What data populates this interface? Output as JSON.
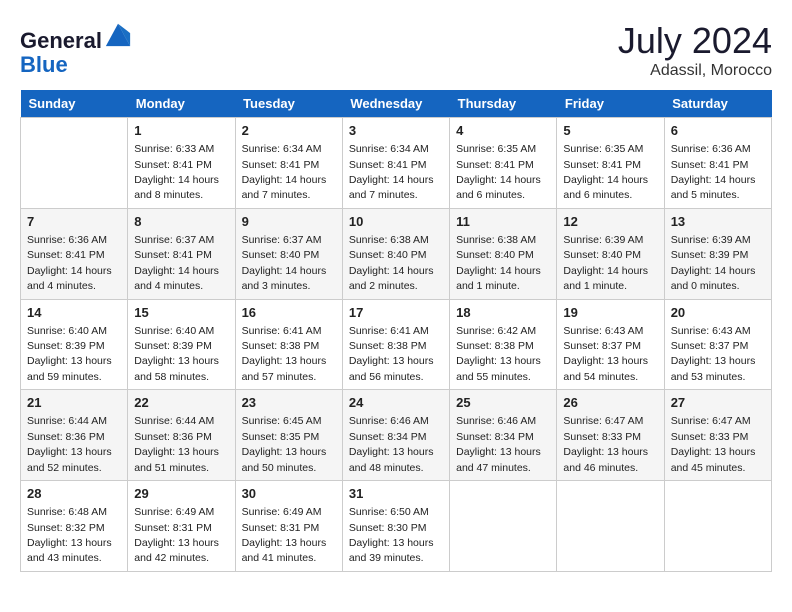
{
  "header": {
    "logo": {
      "line1": "General",
      "line2": "Blue"
    },
    "month": "July 2024",
    "location": "Adassil, Morocco"
  },
  "weekdays": [
    "Sunday",
    "Monday",
    "Tuesday",
    "Wednesday",
    "Thursday",
    "Friday",
    "Saturday"
  ],
  "weeks": [
    [
      {
        "day": null
      },
      {
        "day": 1,
        "sunrise": "6:33 AM",
        "sunset": "8:41 PM",
        "daylight": "14 hours and 8 minutes."
      },
      {
        "day": 2,
        "sunrise": "6:34 AM",
        "sunset": "8:41 PM",
        "daylight": "14 hours and 7 minutes."
      },
      {
        "day": 3,
        "sunrise": "6:34 AM",
        "sunset": "8:41 PM",
        "daylight": "14 hours and 7 minutes."
      },
      {
        "day": 4,
        "sunrise": "6:35 AM",
        "sunset": "8:41 PM",
        "daylight": "14 hours and 6 minutes."
      },
      {
        "day": 5,
        "sunrise": "6:35 AM",
        "sunset": "8:41 PM",
        "daylight": "14 hours and 6 minutes."
      },
      {
        "day": 6,
        "sunrise": "6:36 AM",
        "sunset": "8:41 PM",
        "daylight": "14 hours and 5 minutes."
      }
    ],
    [
      {
        "day": 7,
        "sunrise": "6:36 AM",
        "sunset": "8:41 PM",
        "daylight": "14 hours and 4 minutes."
      },
      {
        "day": 8,
        "sunrise": "6:37 AM",
        "sunset": "8:41 PM",
        "daylight": "14 hours and 4 minutes."
      },
      {
        "day": 9,
        "sunrise": "6:37 AM",
        "sunset": "8:40 PM",
        "daylight": "14 hours and 3 minutes."
      },
      {
        "day": 10,
        "sunrise": "6:38 AM",
        "sunset": "8:40 PM",
        "daylight": "14 hours and 2 minutes."
      },
      {
        "day": 11,
        "sunrise": "6:38 AM",
        "sunset": "8:40 PM",
        "daylight": "14 hours and 1 minute."
      },
      {
        "day": 12,
        "sunrise": "6:39 AM",
        "sunset": "8:40 PM",
        "daylight": "14 hours and 1 minute."
      },
      {
        "day": 13,
        "sunrise": "6:39 AM",
        "sunset": "8:39 PM",
        "daylight": "14 hours and 0 minutes."
      }
    ],
    [
      {
        "day": 14,
        "sunrise": "6:40 AM",
        "sunset": "8:39 PM",
        "daylight": "13 hours and 59 minutes."
      },
      {
        "day": 15,
        "sunrise": "6:40 AM",
        "sunset": "8:39 PM",
        "daylight": "13 hours and 58 minutes."
      },
      {
        "day": 16,
        "sunrise": "6:41 AM",
        "sunset": "8:38 PM",
        "daylight": "13 hours and 57 minutes."
      },
      {
        "day": 17,
        "sunrise": "6:41 AM",
        "sunset": "8:38 PM",
        "daylight": "13 hours and 56 minutes."
      },
      {
        "day": 18,
        "sunrise": "6:42 AM",
        "sunset": "8:38 PM",
        "daylight": "13 hours and 55 minutes."
      },
      {
        "day": 19,
        "sunrise": "6:43 AM",
        "sunset": "8:37 PM",
        "daylight": "13 hours and 54 minutes."
      },
      {
        "day": 20,
        "sunrise": "6:43 AM",
        "sunset": "8:37 PM",
        "daylight": "13 hours and 53 minutes."
      }
    ],
    [
      {
        "day": 21,
        "sunrise": "6:44 AM",
        "sunset": "8:36 PM",
        "daylight": "13 hours and 52 minutes."
      },
      {
        "day": 22,
        "sunrise": "6:44 AM",
        "sunset": "8:36 PM",
        "daylight": "13 hours and 51 minutes."
      },
      {
        "day": 23,
        "sunrise": "6:45 AM",
        "sunset": "8:35 PM",
        "daylight": "13 hours and 50 minutes."
      },
      {
        "day": 24,
        "sunrise": "6:46 AM",
        "sunset": "8:34 PM",
        "daylight": "13 hours and 48 minutes."
      },
      {
        "day": 25,
        "sunrise": "6:46 AM",
        "sunset": "8:34 PM",
        "daylight": "13 hours and 47 minutes."
      },
      {
        "day": 26,
        "sunrise": "6:47 AM",
        "sunset": "8:33 PM",
        "daylight": "13 hours and 46 minutes."
      },
      {
        "day": 27,
        "sunrise": "6:47 AM",
        "sunset": "8:33 PM",
        "daylight": "13 hours and 45 minutes."
      }
    ],
    [
      {
        "day": 28,
        "sunrise": "6:48 AM",
        "sunset": "8:32 PM",
        "daylight": "13 hours and 43 minutes."
      },
      {
        "day": 29,
        "sunrise": "6:49 AM",
        "sunset": "8:31 PM",
        "daylight": "13 hours and 42 minutes."
      },
      {
        "day": 30,
        "sunrise": "6:49 AM",
        "sunset": "8:31 PM",
        "daylight": "13 hours and 41 minutes."
      },
      {
        "day": 31,
        "sunrise": "6:50 AM",
        "sunset": "8:30 PM",
        "daylight": "13 hours and 39 minutes."
      },
      {
        "day": null
      },
      {
        "day": null
      },
      {
        "day": null
      }
    ]
  ]
}
